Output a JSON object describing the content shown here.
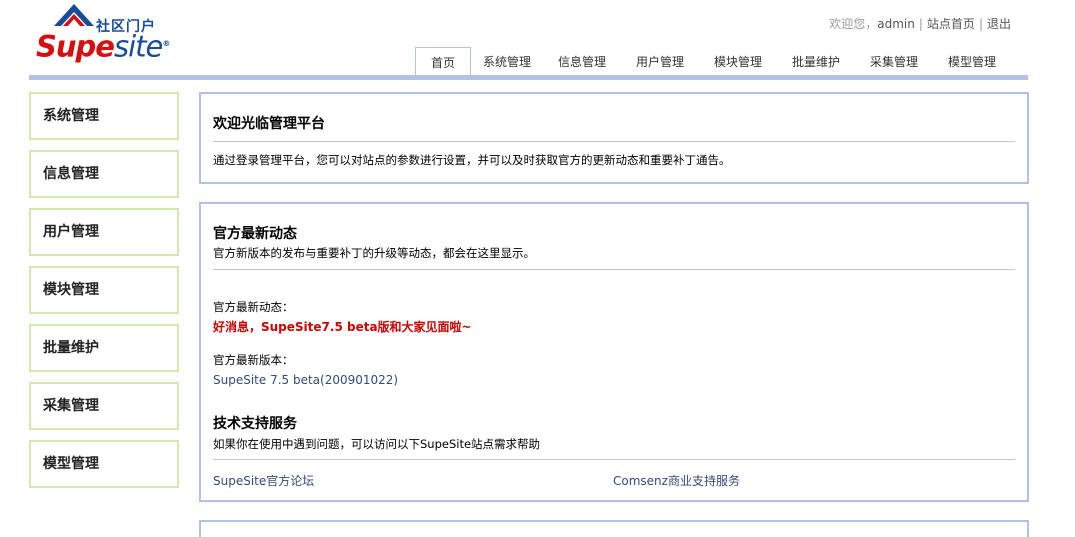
{
  "logo": {
    "cn_text": "社区门户",
    "en_su": "Supe",
    "en_site": "site",
    "reg": "®"
  },
  "toplinks": {
    "welcome": "欢迎您，",
    "user": "admin",
    "sep1": "|",
    "home": "站点首页",
    "sep2": "|",
    "logout": "退出"
  },
  "tabs": [
    "首页",
    "系统管理",
    "信息管理",
    "用户管理",
    "模块管理",
    "批量维护",
    "采集管理",
    "模型管理"
  ],
  "sidebar": {
    "items": [
      "系统管理",
      "信息管理",
      "用户管理",
      "模块管理",
      "批量维护",
      "采集管理",
      "模型管理"
    ]
  },
  "welcome_panel": {
    "title": "欢迎光临管理平台",
    "text": "通过登录管理平台，您可以对站点的参数进行设置，并可以及时获取官方的更新动态和重要补丁通告。"
  },
  "news_panel": {
    "title": "官方最新动态",
    "subtitle": "官方新版本的发布与重要补丁的升级等动态，都会在这里显示。",
    "latest_label": "官方最新动态：",
    "latest_news": "好消息，SupeSite7.5 beta版和大家见面啦~",
    "version_label": "官方最新版本：",
    "version_value": "SupeSite 7.5 beta(200901022)",
    "support_title": "技术支持服务",
    "support_text": "如果你在使用中遇到问题，可以访问以下SupeSite站点需求帮助",
    "link_forum": "SupeSite官方论坛",
    "link_commercial": "Comsenz商业支持服务"
  },
  "colors": {
    "accent_blue": "#b2c1e6",
    "sidebar_border": "#d6e8b0",
    "news_red": "#d10000",
    "link_blue": "#334a7a"
  }
}
